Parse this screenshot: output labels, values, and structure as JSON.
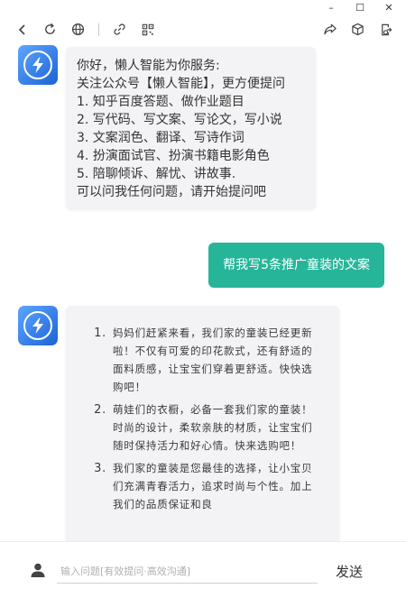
{
  "window": {
    "minimize": "–",
    "maximize": "☐",
    "close": "✕"
  },
  "toolbar": {
    "left_icons": [
      "back-icon",
      "refresh-icon",
      "globe-icon",
      "link-icon",
      "qr-code-icon"
    ],
    "right_icons": [
      "share-icon",
      "cube-icon",
      "export-icon"
    ]
  },
  "colors": {
    "user_bubble": "#27b59a",
    "bot_bubble": "#f3f3f5",
    "avatar": "#3b82f6"
  },
  "greeting": {
    "lines": [
      "你好，懒人智能为你服务:",
      "关注公众号【懒人智能】，更方便提问",
      "1. 知乎百度答题、做作业题目",
      "2. 写代码、写文案、写论文，写小说",
      "3. 文案润色、翻译、写诗作词",
      "4. 扮演面试官、扮演书籍电影角色",
      "5. 陪聊倾诉、解忧、讲故事.",
      "可以问我任何问题，请开始提问吧"
    ]
  },
  "user_message": "帮我写5条推广童装的文案",
  "answer": {
    "items": [
      "妈妈们赶紧来看，我们家的童装已经更新啦！不仅有可爱的印花款式，还有舒适的面料质感，让宝宝们穿着更舒适。快快选购吧！",
      "萌娃们的衣橱，必备一套我们家的童装！时尚的设计，柔软亲肤的材质，让宝宝们随时保持活力和好心情。快来选购吧！",
      "我们家的童装是您最佳的选择，让小宝贝们充满青春活力，追求时尚与个性。加上我们的品质保证和良"
    ]
  },
  "input": {
    "placeholder": "输入问题[有效提问·高效沟通]",
    "value": ""
  },
  "send_label": "发送"
}
